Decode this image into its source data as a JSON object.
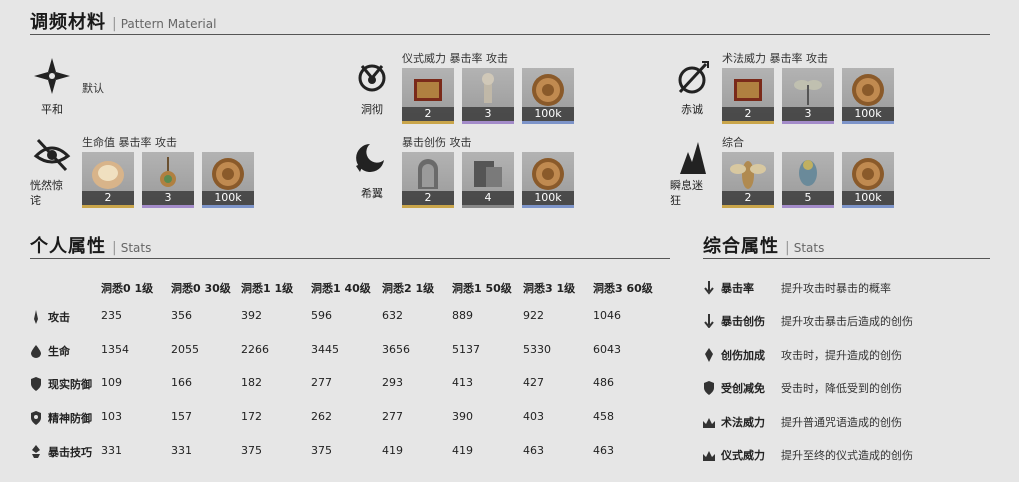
{
  "pattern": {
    "title": "调频材料",
    "subtitle": "Pattern Material",
    "moods": [
      {
        "name": "平和",
        "desc": "默认",
        "items": []
      },
      {
        "name": "洞彻",
        "desc": "仪式威力 暴击率 攻击",
        "items": [
          {
            "qty": "2"
          },
          {
            "qty": "3"
          },
          {
            "qty": "100k"
          }
        ]
      },
      {
        "name": "赤诚",
        "desc": "术法威力 暴击率 攻击",
        "items": [
          {
            "qty": "2"
          },
          {
            "qty": "3"
          },
          {
            "qty": "100k"
          }
        ]
      },
      {
        "name": "恍然惊诧",
        "desc": "生命值 暴击率 攻击",
        "items": [
          {
            "qty": "2"
          },
          {
            "qty": "3"
          },
          {
            "qty": "100k"
          }
        ]
      },
      {
        "name": "希翼",
        "desc": "暴击创伤 攻击",
        "items": [
          {
            "qty": "2"
          },
          {
            "qty": "4"
          },
          {
            "qty": "100k"
          }
        ]
      },
      {
        "name": "瞬息迷狂",
        "desc": "综合",
        "items": [
          {
            "qty": "2"
          },
          {
            "qty": "5"
          },
          {
            "qty": "100k"
          }
        ]
      }
    ]
  },
  "stats": {
    "title": "个人属性",
    "subtitle": "Stats",
    "columns": [
      "洞悉0 1级",
      "洞悉0 30级",
      "洞悉1 1级",
      "洞悉1 40级",
      "洞悉2 1级",
      "洞悉1 50级",
      "洞悉3 1级",
      "洞悉3 60级"
    ],
    "rows": [
      {
        "label": "攻击",
        "icon": "attack-icon",
        "values": [
          "235",
          "356",
          "392",
          "596",
          "632",
          "889",
          "922",
          "1046"
        ]
      },
      {
        "label": "生命",
        "icon": "health-icon",
        "values": [
          "1354",
          "2055",
          "2266",
          "3445",
          "3656",
          "5137",
          "5330",
          "6043"
        ]
      },
      {
        "label": "现实防御",
        "icon": "reality-defense-icon",
        "values": [
          "109",
          "166",
          "182",
          "277",
          "293",
          "413",
          "427",
          "486"
        ]
      },
      {
        "label": "精神防御",
        "icon": "mental-defense-icon",
        "values": [
          "103",
          "157",
          "172",
          "262",
          "277",
          "390",
          "403",
          "458"
        ]
      },
      {
        "label": "暴击技巧",
        "icon": "crit-technique-icon",
        "values": [
          "331",
          "331",
          "375",
          "375",
          "419",
          "419",
          "463",
          "463"
        ]
      }
    ]
  },
  "attributes": {
    "title": "综合属性",
    "subtitle": "Stats",
    "items": [
      {
        "label": "暴击率",
        "desc": "提升攻击时暴击的概率"
      },
      {
        "label": "暴击创伤",
        "desc": "提升攻击暴击后造成的创伤"
      },
      {
        "label": "创伤加成",
        "desc": "攻击时，提升造成的创伤"
      },
      {
        "label": "受创减免",
        "desc": "受击时，降低受到的创伤"
      },
      {
        "label": "术法威力",
        "desc": "提升普通咒语造成的创伤"
      },
      {
        "label": "仪式威力",
        "desc": "提升至终的仪式造成的创伤"
      }
    ]
  }
}
